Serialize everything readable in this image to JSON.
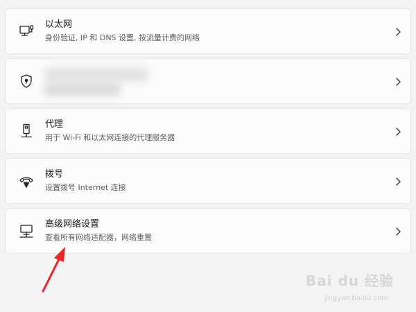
{
  "items": [
    {
      "icon": "ethernet-icon",
      "title": "以太网",
      "subtitle": "身份验证, IP 和 DNS 设置, 按流量计费的网络"
    },
    {
      "icon": "shield-lock-icon",
      "title": "",
      "subtitle": ""
    },
    {
      "icon": "proxy-icon",
      "title": "代理",
      "subtitle": "用于 Wi-Fi 和以太网连接的代理服务器"
    },
    {
      "icon": "dial-up-icon",
      "title": "拨号",
      "subtitle": "设置拨号 Internet 连接"
    },
    {
      "icon": "advanced-network-icon",
      "title": "高级网络设置",
      "subtitle": "查看所有网络适配器，网络重置"
    }
  ],
  "watermark": {
    "text": "Bai du 经验",
    "url": "jingyan.baidu.com"
  },
  "colors": {
    "background": "#f3f3f3",
    "card": "#fbfbfb",
    "arrow": "#e8262a"
  }
}
